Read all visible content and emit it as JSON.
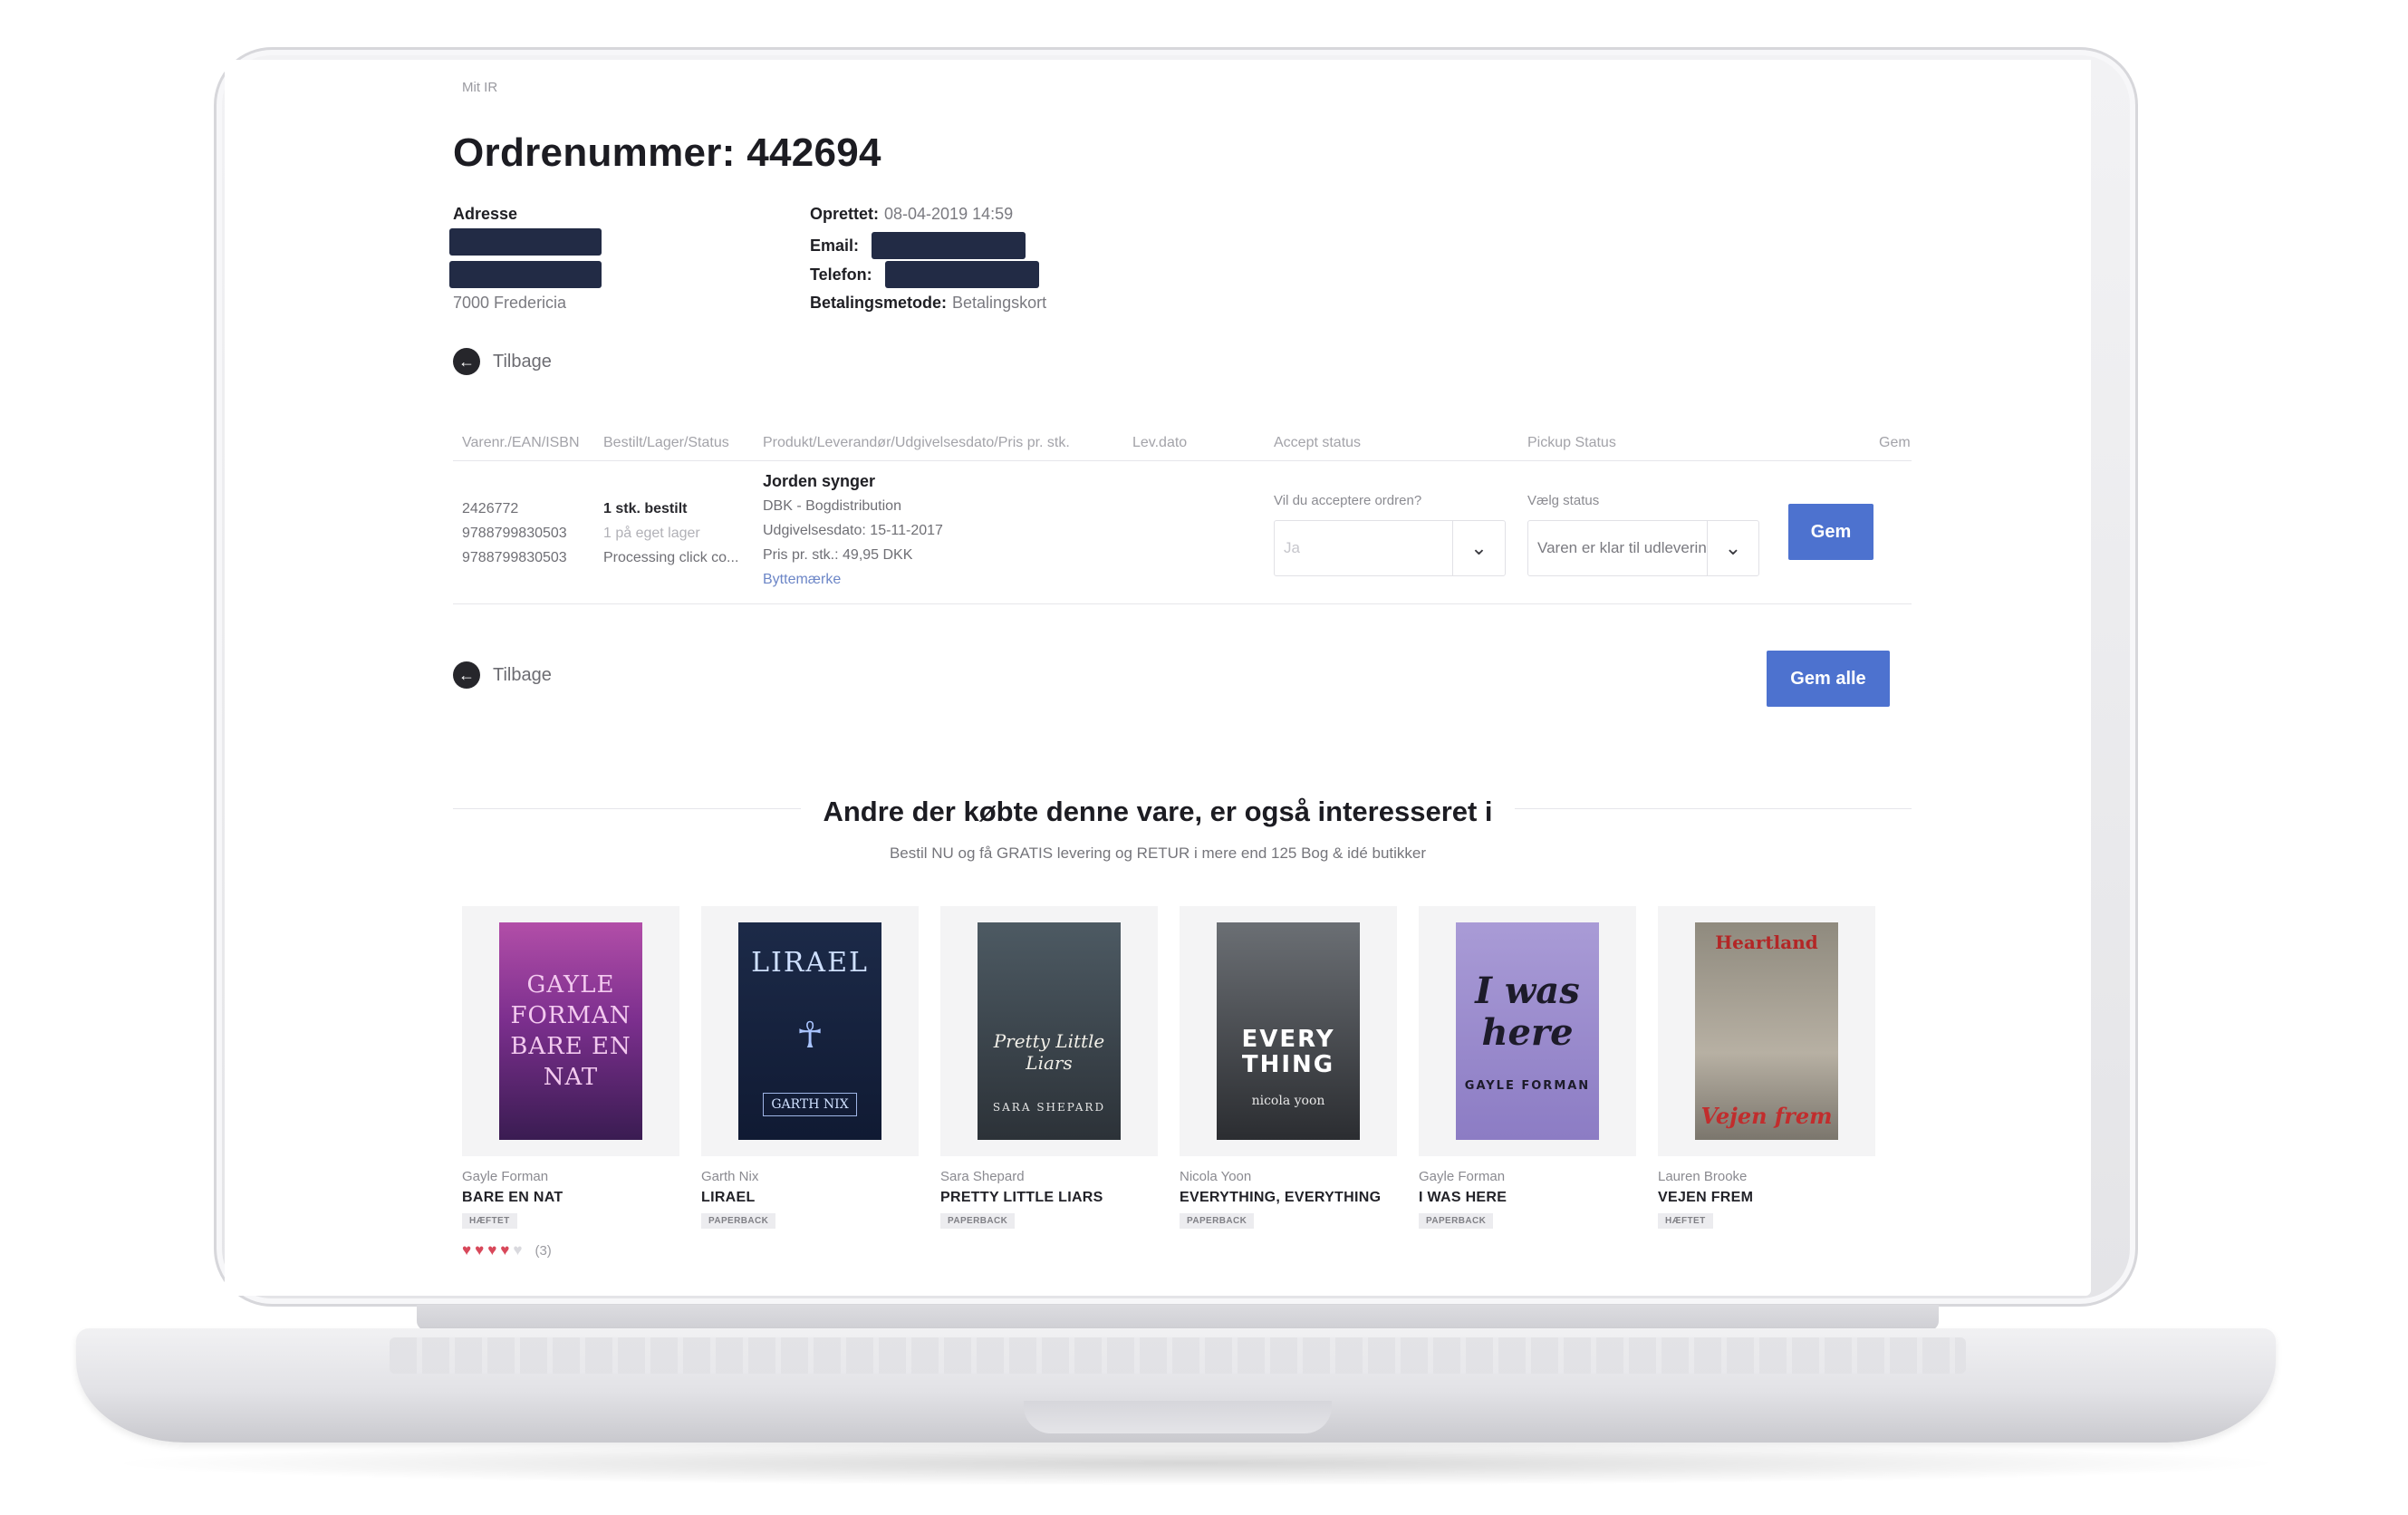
{
  "breadcrumb": "Mit IR",
  "order": {
    "title": "Ordrenummer: 442694",
    "address_label": "Adresse",
    "address_city": "7000 Fredericia",
    "created_label": "Oprettet:",
    "created_value": "08-04-2019 14:59",
    "email_label": "Email:",
    "phone_label": "Telefon:",
    "payment_label": "Betalingsmetode:",
    "payment_value": "Betalingskort"
  },
  "back_label": "Tilbage",
  "table": {
    "headers": [
      "Varenr./EAN/ISBN",
      "Bestilt/Lager/Status",
      "Produkt/Leverandør/Udgivelsesdato/Pris pr. stk.",
      "Lev.dato",
      "Accept status",
      "Pickup Status",
      "Gem"
    ],
    "row": {
      "ids": [
        "2426772",
        "9788799830503",
        "9788799830503"
      ],
      "ordered": "1 stk. bestilt",
      "stock": "1 på eget lager",
      "status": "Processing click co...",
      "product_title": "Jorden synger",
      "supplier": "DBK - Bogdistribution",
      "release": "Udgivelsesdato: 15-11-2017",
      "price": "Pris pr. stk.: 49,95 DKK",
      "swap_link": "Byttemærke",
      "accept_label": "Vil du acceptere ordren?",
      "accept_value": "Ja",
      "pickup_label": "Vælg status",
      "pickup_value": "Varen er klar til udlevering",
      "save_label": "Gem"
    }
  },
  "save_all_label": "Gem alle",
  "recommendations": {
    "title": "Andre der købte denne vare, er også interesseret i",
    "subtitle": "Bestil NU og få GRATIS levering og RETUR i mere end 125 Bog & idé butikker",
    "books": [
      {
        "author": "Gayle Forman",
        "title": "BARE EN NAT",
        "format": "HÆFTET",
        "cover_text": "GAYLE FORMAN BARE EN NAT",
        "rating": 4,
        "rating_count": "(3)"
      },
      {
        "author": "Garth Nix",
        "title": "LIRAEL",
        "format": "PAPERBACK",
        "cover_text": "LIRAEL",
        "cover_sub": "GARTH NIX"
      },
      {
        "author": "Sara Shepard",
        "title": "PRETTY LITTLE LIARS",
        "format": "PAPERBACK",
        "cover_text": "Pretty Little Liars",
        "cover_sub": "SARA SHEPARD"
      },
      {
        "author": "Nicola Yoon",
        "title": "EVERYTHING, EVERYTHING",
        "format": "PAPERBACK",
        "cover_text": "EVERY THING",
        "cover_sub": "nicola yoon"
      },
      {
        "author": "Gayle Forman",
        "title": "I WAS HERE",
        "format": "PAPERBACK",
        "cover_text": "I was here",
        "cover_sub": "GAYLE FORMAN"
      },
      {
        "author": "Lauren Brooke",
        "title": "VEJEN FREM",
        "format": "HÆFTET",
        "cover_text": "Vejen frem",
        "cover_sub": "Heartland"
      }
    ]
  },
  "colors": {
    "primary_button": "#4d72cf",
    "redaction": "#222b45",
    "rating": "#d8485a"
  },
  "icons": {
    "back": "arrow-left-circle-icon",
    "dropdown": "chevron-down-icon",
    "star": "heart-star-icon"
  }
}
